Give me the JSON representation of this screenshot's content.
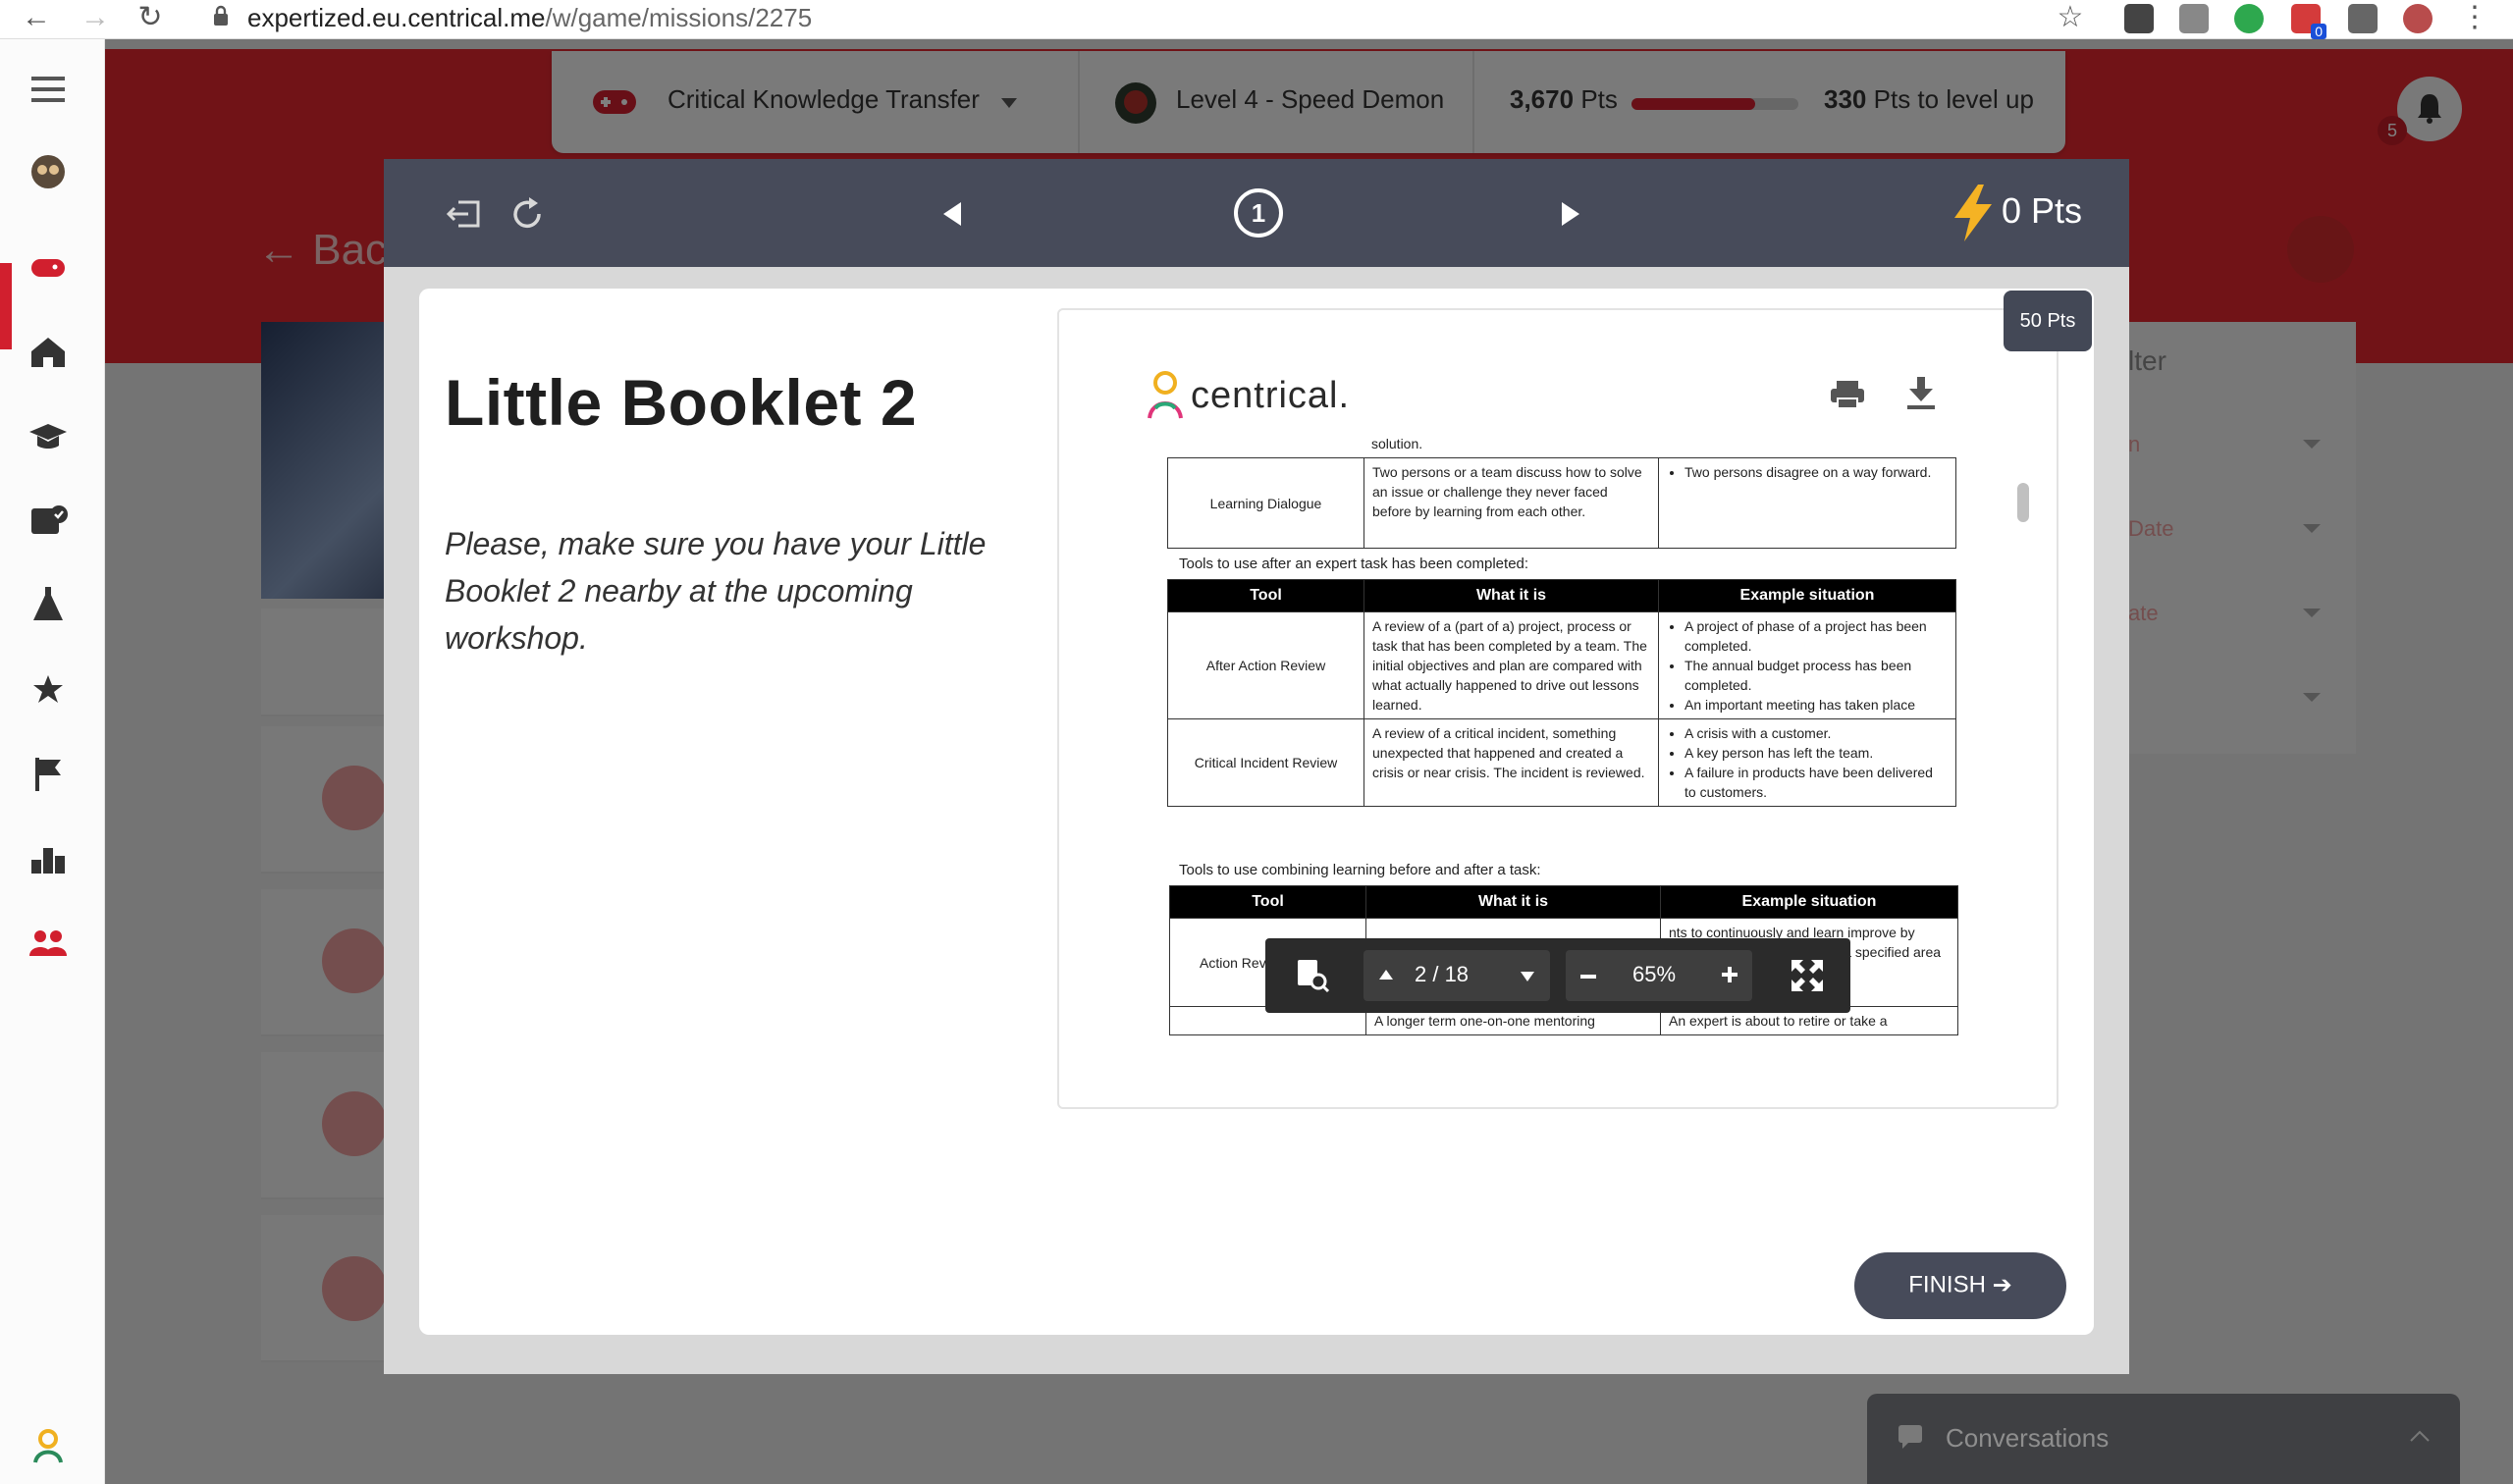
{
  "browser": {
    "url_main": "expertized.eu.centrical.me",
    "url_path": "/w/game/missions/2275",
    "notification_badge": "0"
  },
  "top_stats": {
    "mission_name": "Critical Knowledge Transfer",
    "level": "Level 4 - Speed Demon",
    "points": "3,670",
    "points_unit": "Pts",
    "progress_fraction": 0.74,
    "to_level_up_value": "330",
    "to_level_up_text": "Pts to level up",
    "bell_count": "5"
  },
  "background_page": {
    "back_label": "Back",
    "filter_title": "lter",
    "filter_items": [
      "n",
      "Date",
      "ate",
      ""
    ],
    "conversations_label": "Conversations"
  },
  "modal": {
    "step_number": "1",
    "points_earned": "0 Pts",
    "card_points": "50 Pts",
    "title": "Little Booklet 2",
    "description": "Please, make sure you have your Little Booklet 2 nearby at the upcoming workshop.",
    "finish_label": "FINISH"
  },
  "pdf": {
    "logo_text": "centrical.",
    "top_fragment": "solution.",
    "learning_dialogue": {
      "tool": "Learning Dialogue",
      "what": "Two persons or a team discuss how to solve an issue or challenge they never faced before by learning from each other.",
      "example": "Two persons disagree on a way forward."
    },
    "caption_after": "Tools to use after an expert task has been completed:",
    "headers": [
      "Tool",
      "What it is",
      "Example situation"
    ],
    "after_action": {
      "tool": "After Action Review",
      "what": "A review of a (part of a) project, process or task that has been completed by a team. The initial objectives and plan are compared with what actually happened to drive out lessons learned.",
      "examples": [
        "A project of phase of a project has been completed.",
        "The annual budget process has been completed.",
        "An important meeting has taken place"
      ]
    },
    "critical_incident": {
      "tool": "Critical Incident Review",
      "what": "A review of a critical incident, something unexpected that happened and created a crisis or near crisis. The incident is reviewed.",
      "examples": [
        "A crisis with a customer.",
        "A key person has left the team.",
        "A failure in products have been delivered to customers."
      ]
    },
    "caption_combining": "Tools to use combining learning before and after a task:",
    "action_review": {
      "tool": "Action Review",
      "example_fragment": "nts to continuously and learn improve by eriences increase results on a specified area of expertise."
    },
    "mentoring": {
      "what_fragment": "A longer term one-on-one mentoring",
      "example_fragment": "An expert is about to retire or take a"
    },
    "toolbar": {
      "page_display": "2 / 18",
      "zoom": "65%"
    }
  },
  "colors": {
    "brand_red": "#e2272f",
    "modal_header": "#474b5a",
    "progress_fill": "#d21f2e"
  }
}
